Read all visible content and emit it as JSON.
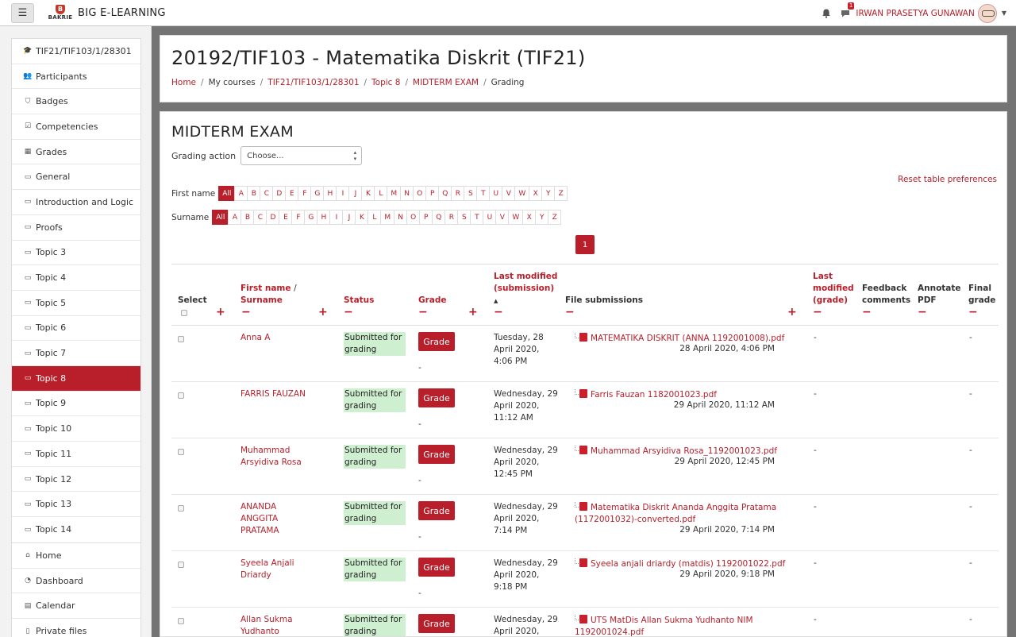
{
  "navbar": {
    "site_name": "BIG E-LEARNING",
    "logo_text": "UNIVERSITAS BAKRIE",
    "user_name": "IRWAN PRASETYA GUNAWAN",
    "message_count": "1",
    "icons": [
      "menu-icon",
      "bell-icon",
      "message-icon",
      "user-avatar"
    ]
  },
  "sidebar": {
    "course_items": [
      {
        "label": "TIF21/TIF103/1/28301",
        "icon": "graduation-cap-icon"
      },
      {
        "label": "Participants",
        "icon": "users-icon"
      },
      {
        "label": "Badges",
        "icon": "shield-icon"
      },
      {
        "label": "Competencies",
        "icon": "checkbox-icon"
      },
      {
        "label": "Grades",
        "icon": "table-icon"
      },
      {
        "label": "General",
        "icon": "folder-icon"
      },
      {
        "label": "Introduction and Logic",
        "icon": "folder-icon"
      },
      {
        "label": "Proofs",
        "icon": "folder-icon"
      },
      {
        "label": "Topic 3",
        "icon": "folder-icon"
      },
      {
        "label": "Topic 4",
        "icon": "folder-icon"
      },
      {
        "label": "Topic 5",
        "icon": "folder-icon"
      },
      {
        "label": "Topic 6",
        "icon": "folder-icon"
      },
      {
        "label": "Topic 7",
        "icon": "folder-icon"
      },
      {
        "label": "Topic 8",
        "icon": "folder-icon",
        "active": true
      },
      {
        "label": "Topic 9",
        "icon": "folder-icon"
      },
      {
        "label": "Topic 10",
        "icon": "folder-icon"
      },
      {
        "label": "Topic 11",
        "icon": "folder-icon"
      },
      {
        "label": "Topic 12",
        "icon": "folder-icon"
      },
      {
        "label": "Topic 13",
        "icon": "folder-icon"
      },
      {
        "label": "Topic 14",
        "icon": "folder-icon"
      }
    ],
    "site_items": [
      {
        "label": "Home",
        "icon": "home-icon"
      },
      {
        "label": "Dashboard",
        "icon": "dashboard-icon"
      },
      {
        "label": "Calendar",
        "icon": "calendar-icon"
      },
      {
        "label": "Private files",
        "icon": "file-icon"
      }
    ]
  },
  "header": {
    "title": "20192/TIF103 - Matematika Diskrit (TIF21)",
    "breadcrumb": [
      {
        "label": "Home",
        "link": true
      },
      {
        "label": "My courses",
        "link": false
      },
      {
        "label": "TIF21/TIF103/1/28301",
        "link": true
      },
      {
        "label": "Topic 8",
        "link": true
      },
      {
        "label": "MIDTERM EXAM",
        "link": true
      },
      {
        "label": "Grading",
        "link": false
      }
    ]
  },
  "main": {
    "title": "MIDTERM EXAM",
    "grading_action_label": "Grading action",
    "grading_action_value": "Choose...",
    "reset_label": "Reset table preferences",
    "first_name_label": "First name",
    "surname_label": "Surname",
    "all_label": "All",
    "letters": [
      "A",
      "B",
      "C",
      "D",
      "E",
      "F",
      "G",
      "H",
      "I",
      "J",
      "K",
      "L",
      "M",
      "N",
      "O",
      "P",
      "Q",
      "R",
      "S",
      "T",
      "U",
      "V",
      "W",
      "X",
      "Y",
      "Z"
    ],
    "page_number": "1"
  },
  "table": {
    "headers": {
      "select": "Select",
      "first_name": "First name",
      "slash": "/",
      "surname": "Surname",
      "status": "Status",
      "grade": "Grade",
      "last_modified_submission_1": "Last modified",
      "last_modified_submission_2": "(submission)",
      "file_submissions": "File submissions",
      "last_modified_grade_1": "Last",
      "last_modified_grade_2": "modified",
      "last_modified_grade_3": "(grade)",
      "feedback_1": "Feedback",
      "feedback_2": "comments",
      "annotate_1": "Annotate",
      "annotate_2": "PDF",
      "final_1": "Final",
      "final_2": "grade",
      "sort_indicator": "▲",
      "plus": "+",
      "minus": "−"
    },
    "status_line1": "Submitted for",
    "status_line2": "grading",
    "grade_button": "Grade",
    "dash": "-",
    "rows": [
      {
        "name_lines": [
          "Anna A"
        ],
        "modified": [
          "Tuesday, 28",
          "April 2020,",
          "4:06 PM"
        ],
        "file_lines": [
          "MATEMATIKA DISKRIT (ANNA 1192001008).pdf"
        ],
        "file_date": "28 April 2020, 4:06 PM"
      },
      {
        "name_lines": [
          "FARRIS FAUZAN"
        ],
        "modified": [
          "Wednesday, 29",
          "April 2020,",
          "11:12 AM"
        ],
        "file_lines": [
          "Farris Fauzan 1182001023.pdf"
        ],
        "file_date": "29 April 2020, 11:12 AM"
      },
      {
        "name_lines": [
          "Muhammad",
          "Arsyidiva Rosa"
        ],
        "modified": [
          "Wednesday, 29",
          "April 2020,",
          "12:45 PM"
        ],
        "file_lines": [
          "Muhammad Arsyidiva Rosa_1192001023.pdf"
        ],
        "file_date": "29 April 2020, 12:45 PM"
      },
      {
        "name_lines": [
          "ANANDA",
          "ANGGITA",
          "PRATAMA"
        ],
        "modified": [
          "Wednesday, 29",
          "April 2020,",
          "7:14 PM"
        ],
        "file_lines": [
          "Matematika Diskrit Ananda Anggita Pratama",
          "(1172001032)-converted.pdf"
        ],
        "file_date": "29 April 2020, 7:14 PM"
      },
      {
        "name_lines": [
          "Syeela Anjali",
          "Driardy"
        ],
        "modified": [
          "Wednesday, 29",
          "April 2020,",
          "9:18 PM"
        ],
        "file_lines": [
          "Syeela anjali driardy (matdis) 1192001022.pdf"
        ],
        "file_date": "29 April 2020, 9:18 PM"
      },
      {
        "name_lines": [
          "Allan Sukma",
          "Yudhanto"
        ],
        "modified": [
          "Wednesday, 29",
          "April 2020,",
          ""
        ],
        "file_lines": [
          "UTS MatDis Allan Sukma Yudhanto NIM",
          "1192001024.pdf"
        ],
        "file_date": ""
      }
    ]
  },
  "colors": {
    "accent": "#b81f2a",
    "status_bg": "#cfefd1",
    "backdrop": "#747474"
  }
}
